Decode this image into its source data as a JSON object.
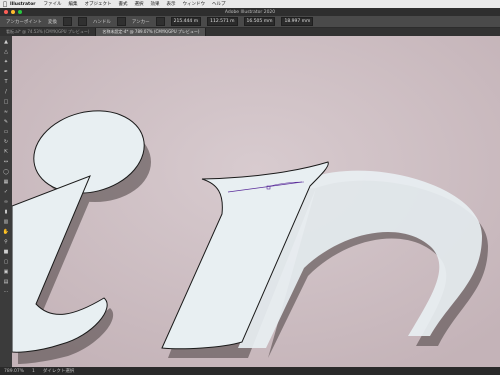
{
  "menubar": {
    "app_name": "Illustrator",
    "items": [
      "ファイル",
      "編集",
      "オブジェクト",
      "書式",
      "選択",
      "効果",
      "表示",
      "ウィンドウ",
      "ヘルプ"
    ]
  },
  "titlebar": {
    "title": "Adobe Illustrator 2020"
  },
  "control": {
    "section_label": "アンカーポイント",
    "convert_label": "変換",
    "handle_label": "ハンドル",
    "anchor_label": "アンカー",
    "x_value": "215.444 m",
    "y_value": "112.571 m",
    "w_value": "16.505 mm",
    "h_value": "18.997 mm"
  },
  "tabs": [
    {
      "label": "看板.ai* @ 74.53% (CMYK/GPU プレビュー)",
      "active": false
    },
    {
      "label": "名称未設定-4* @ 789.07% (CMYK/GPU プレビュー)",
      "active": true
    }
  ],
  "status": {
    "zoom": "789.07%",
    "page": "1",
    "mode": "ダイレクト選択"
  },
  "colors": {
    "canvas_bg": "#cfc0c4",
    "shape_fill": "#e8eff2",
    "shape_outline": "#1a1a1a",
    "selection": "#5a2c9a"
  }
}
